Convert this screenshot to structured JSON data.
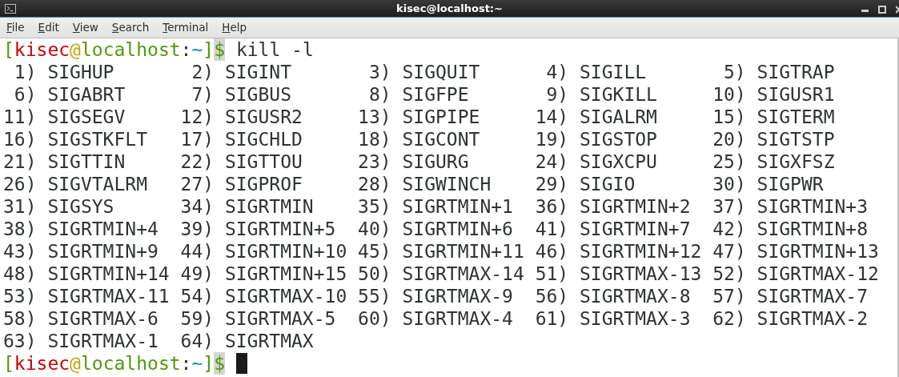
{
  "window": {
    "title": "kisec@localhost:~"
  },
  "menu": [
    "File",
    "Edit",
    "View",
    "Search",
    "Terminal",
    "Help"
  ],
  "terminal": {
    "lines": [
      {
        "kind": "prompt",
        "parts": [
          {
            "text": "[",
            "color": "#4e9a06"
          },
          {
            "text": "kisec",
            "color": "#cc0000"
          },
          {
            "text": "@",
            "color": "#c4a000"
          },
          {
            "text": "localhost",
            "color": "#4e9a06"
          },
          {
            "text": ":",
            "color": "#2e3436"
          },
          {
            "text": "~",
            "color": "#06989a"
          },
          {
            "text": "]",
            "color": "#4e9a06"
          },
          {
            "text": "$",
            "color": "#4e9a06",
            "highlighted": true
          }
        ],
        "command": "kill -l",
        "cursor": false
      },
      {
        "kind": "signals",
        "entries": [
          {
            "number": "1)",
            "name": "SIGHUP"
          },
          {
            "number": "2)",
            "name": "SIGINT"
          },
          {
            "number": "3)",
            "name": "SIGQUIT"
          },
          {
            "number": "4)",
            "name": "SIGILL"
          },
          {
            "number": "5)",
            "name": "SIGTRAP"
          }
        ]
      },
      {
        "kind": "signals",
        "entries": [
          {
            "number": "6)",
            "name": "SIGABRT"
          },
          {
            "number": "7)",
            "name": "SIGBUS"
          },
          {
            "number": "8)",
            "name": "SIGFPE"
          },
          {
            "number": "9)",
            "name": "SIGKILL"
          },
          {
            "number": "10)",
            "name": "SIGUSR1"
          }
        ]
      },
      {
        "kind": "signals",
        "entries": [
          {
            "number": "11)",
            "name": "SIGSEGV"
          },
          {
            "number": "12)",
            "name": "SIGUSR2"
          },
          {
            "number": "13)",
            "name": "SIGPIPE"
          },
          {
            "number": "14)",
            "name": "SIGALRM"
          },
          {
            "number": "15)",
            "name": "SIGTERM"
          }
        ]
      },
      {
        "kind": "signals",
        "entries": [
          {
            "number": "16)",
            "name": "SIGSTKFLT"
          },
          {
            "number": "17)",
            "name": "SIGCHLD"
          },
          {
            "number": "18)",
            "name": "SIGCONT"
          },
          {
            "number": "19)",
            "name": "SIGSTOP"
          },
          {
            "number": "20)",
            "name": "SIGTSTP"
          }
        ]
      },
      {
        "kind": "signals",
        "entries": [
          {
            "number": "21)",
            "name": "SIGTTIN"
          },
          {
            "number": "22)",
            "name": "SIGTTOU"
          },
          {
            "number": "23)",
            "name": "SIGURG"
          },
          {
            "number": "24)",
            "name": "SIGXCPU"
          },
          {
            "number": "25)",
            "name": "SIGXFSZ"
          }
        ]
      },
      {
        "kind": "signals",
        "entries": [
          {
            "number": "26)",
            "name": "SIGVTALRM"
          },
          {
            "number": "27)",
            "name": "SIGPROF"
          },
          {
            "number": "28)",
            "name": "SIGWINCH"
          },
          {
            "number": "29)",
            "name": "SIGIO"
          },
          {
            "number": "30)",
            "name": "SIGPWR"
          }
        ]
      },
      {
        "kind": "signals",
        "entries": [
          {
            "number": "31)",
            "name": "SIGSYS"
          },
          {
            "number": "34)",
            "name": "SIGRTMIN"
          },
          {
            "number": "35)",
            "name": "SIGRTMIN+1"
          },
          {
            "number": "36)",
            "name": "SIGRTMIN+2"
          },
          {
            "number": "37)",
            "name": "SIGRTMIN+3"
          }
        ]
      },
      {
        "kind": "signals",
        "entries": [
          {
            "number": "38)",
            "name": "SIGRTMIN+4"
          },
          {
            "number": "39)",
            "name": "SIGRTMIN+5"
          },
          {
            "number": "40)",
            "name": "SIGRTMIN+6"
          },
          {
            "number": "41)",
            "name": "SIGRTMIN+7"
          },
          {
            "number": "42)",
            "name": "SIGRTMIN+8"
          }
        ]
      },
      {
        "kind": "signals",
        "entries": [
          {
            "number": "43)",
            "name": "SIGRTMIN+9"
          },
          {
            "number": "44)",
            "name": "SIGRTMIN+10"
          },
          {
            "number": "45)",
            "name": "SIGRTMIN+11"
          },
          {
            "number": "46)",
            "name": "SIGRTMIN+12"
          },
          {
            "number": "47)",
            "name": "SIGRTMIN+13"
          }
        ]
      },
      {
        "kind": "signals",
        "entries": [
          {
            "number": "48)",
            "name": "SIGRTMIN+14"
          },
          {
            "number": "49)",
            "name": "SIGRTMIN+15"
          },
          {
            "number": "50)",
            "name": "SIGRTMAX-14"
          },
          {
            "number": "51)",
            "name": "SIGRTMAX-13"
          },
          {
            "number": "52)",
            "name": "SIGRTMAX-12"
          }
        ]
      },
      {
        "kind": "signals",
        "entries": [
          {
            "number": "53)",
            "name": "SIGRTMAX-11"
          },
          {
            "number": "54)",
            "name": "SIGRTMAX-10"
          },
          {
            "number": "55)",
            "name": "SIGRTMAX-9"
          },
          {
            "number": "56)",
            "name": "SIGRTMAX-8"
          },
          {
            "number": "57)",
            "name": "SIGRTMAX-7"
          }
        ]
      },
      {
        "kind": "signals",
        "entries": [
          {
            "number": "58)",
            "name": "SIGRTMAX-6"
          },
          {
            "number": "59)",
            "name": "SIGRTMAX-5"
          },
          {
            "number": "60)",
            "name": "SIGRTMAX-4"
          },
          {
            "number": "61)",
            "name": "SIGRTMAX-3"
          },
          {
            "number": "62)",
            "name": "SIGRTMAX-2"
          }
        ]
      },
      {
        "kind": "signals",
        "entries": [
          {
            "number": "63)",
            "name": "SIGRTMAX-1"
          },
          {
            "number": "64)",
            "name": "SIGRTMAX"
          }
        ]
      },
      {
        "kind": "prompt",
        "parts": [
          {
            "text": "[",
            "color": "#4e9a06"
          },
          {
            "text": "kisec",
            "color": "#cc0000"
          },
          {
            "text": "@",
            "color": "#c4a000"
          },
          {
            "text": "localhost",
            "color": "#4e9a06"
          },
          {
            "text": ":",
            "color": "#2e3436"
          },
          {
            "text": "~",
            "color": "#06989a"
          },
          {
            "text": "]",
            "color": "#4e9a06"
          },
          {
            "text": "$",
            "color": "#4e9a06",
            "highlighted": true
          }
        ],
        "cursor": true
      }
    ]
  }
}
